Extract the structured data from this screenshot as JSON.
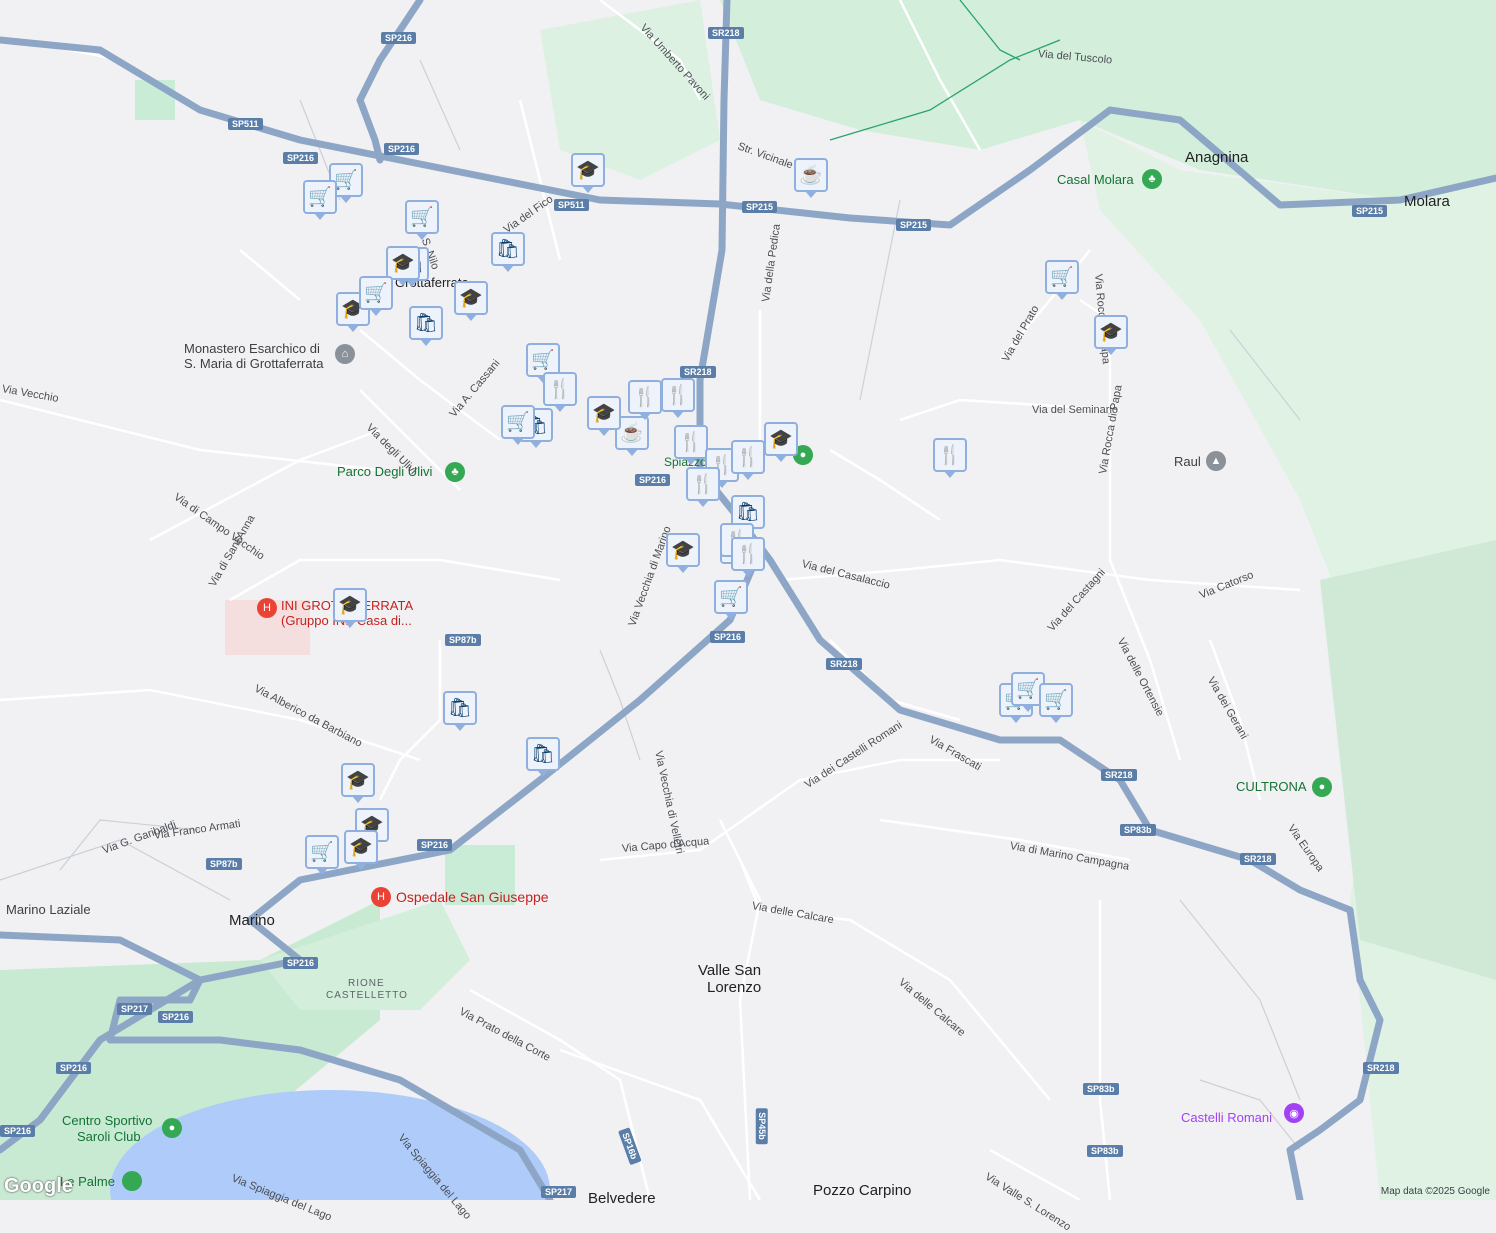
{
  "map": {
    "colors": {
      "land": "#f1f1f3",
      "park": "#c9ecd6",
      "forest": "#d7f0de",
      "highway": "#8ea6c6",
      "road": "#ffffff",
      "road_outline": "#d5d8de",
      "marker_bg": "#eef3fb",
      "marker_border": "#8fb0df",
      "marker_icon": "#0b3d6b"
    },
    "place_labels": [
      {
        "name": "anagnina",
        "text": "Anagnina"
      },
      {
        "name": "molara",
        "text": "Molara"
      },
      {
        "name": "valle-san-lorenzo-1",
        "text": "Valle San"
      },
      {
        "name": "valle-san-lorenzo-2",
        "text": "Lorenzo"
      },
      {
        "name": "marino",
        "text": "Marino"
      },
      {
        "name": "pozzo-carpino",
        "text": "Pozzo Carpino"
      },
      {
        "name": "belvedere",
        "text": "Belvedere"
      },
      {
        "name": "grottaferrata",
        "text": "Grottaferrata"
      }
    ],
    "street_labels": [
      "Via Umberto Pavoni",
      "Via del Tuscolo",
      "Str. Vicinale",
      "Via della Pedica",
      "Via del Prato",
      "Via Rocca di Papa",
      "Via del Seminario",
      "Via Rocca di Papa",
      "Via del Casalaccio",
      "Via del Castagni",
      "Via Catorso",
      "Via delle Ortensie",
      "Via dei Gerani",
      "Via Europa",
      "Via Frascati",
      "Via dei Castelli Romani",
      "Via di Marino Campagna",
      "Via Vecchia di Velletri",
      "Via Vecchia di Marino",
      "Via Capo d'Acqua",
      "Via delle Calcare",
      "Via delle Calcare",
      "Via Prato della Corte",
      "Via Spiaggia del Lago",
      "Via Spiaggia del Lago",
      "Via Valle S. Lorenzo",
      "Via G. Garibaldi",
      "Via Franco Armati",
      "Via Alberico da Barbiano",
      "Via di Sant'Anna",
      "Via di Campo Vecchio",
      "Via degli Ulivi",
      "Via A. Cassani",
      "Via del Fico",
      "Via S. Nilo",
      "Via Vecchio"
    ],
    "area_labels": [
      {
        "text": "RIONE"
      },
      {
        "text": "CASTELLETTO"
      }
    ],
    "shields": [
      "SP216",
      "SR218",
      "SP511",
      "SP216",
      "SP511",
      "SP215",
      "SP215",
      "SP215",
      "SR218",
      "SP216",
      "SP216",
      "SR218",
      "SR218",
      "SP83b",
      "SR218",
      "SP87b",
      "SP87b",
      "SP216",
      "SP216",
      "SP217",
      "SP216",
      "SP216",
      "SP83b",
      "SP83b",
      "SR218",
      "SP45b",
      "SP16b",
      "SP217",
      "SP216"
    ],
    "pois": [
      {
        "name": "casal-molara",
        "text": "Casal Molara",
        "kind": "green"
      },
      {
        "name": "parco-degli-ulivi",
        "text": "Parco Degli Ulivi",
        "kind": "green"
      },
      {
        "name": "centro-sportivo-1",
        "text": "Centro Sportivo",
        "kind": "green"
      },
      {
        "name": "centro-sportivo-2",
        "text": "Saroli Club",
        "kind": "green"
      },
      {
        "name": "le-palme",
        "text": "Le Palme",
        "kind": "green"
      },
      {
        "name": "cultrona",
        "text": "CULTRONA",
        "kind": "green"
      },
      {
        "name": "raul",
        "text": "Raul",
        "kind": "dark"
      },
      {
        "name": "ospedale-san-giuseppe",
        "text": "Ospedale San Giuseppe",
        "kind": "red"
      },
      {
        "name": "ini-grottaferrata-1",
        "text": "INI GROTTAFERRATA",
        "kind": "red"
      },
      {
        "name": "ini-grottaferrata-2",
        "text": "(Gruppo INI) Casa di...",
        "kind": "red"
      },
      {
        "name": "monastero-1",
        "text": "Monastero Esarchico di",
        "kind": "dark"
      },
      {
        "name": "monastero-2",
        "text": "S. Maria di Grottaferrata",
        "kind": "dark"
      },
      {
        "name": "marino-laziale",
        "text": "Marino Laziale",
        "kind": "dark"
      },
      {
        "name": "castelli-romani",
        "text": "Castelli Romani",
        "kind": "purple"
      },
      {
        "name": "square",
        "text": "Spiazzo Marconi",
        "kind": "green"
      }
    ],
    "markers": [
      "school",
      "cafe",
      "cart",
      "cart",
      "cart",
      "bag",
      "bag",
      "school",
      "school",
      "bag",
      "school",
      "cart",
      "cart",
      "restaurant",
      "bag",
      "cafe",
      "restaurant",
      "restaurant",
      "restaurant",
      "restaurant",
      "restaurant",
      "school",
      "restaurant",
      "restaurant",
      "bag",
      "restaurant",
      "restaurant",
      "school",
      "cart",
      "cart",
      "school",
      "restaurant",
      "cart",
      "cart",
      "cart",
      "bag",
      "bag",
      "school",
      "school",
      "school",
      "cart",
      "school",
      "cart",
      "school"
    ],
    "attribution": "Map data ©2025 Google",
    "logo": "Google"
  }
}
